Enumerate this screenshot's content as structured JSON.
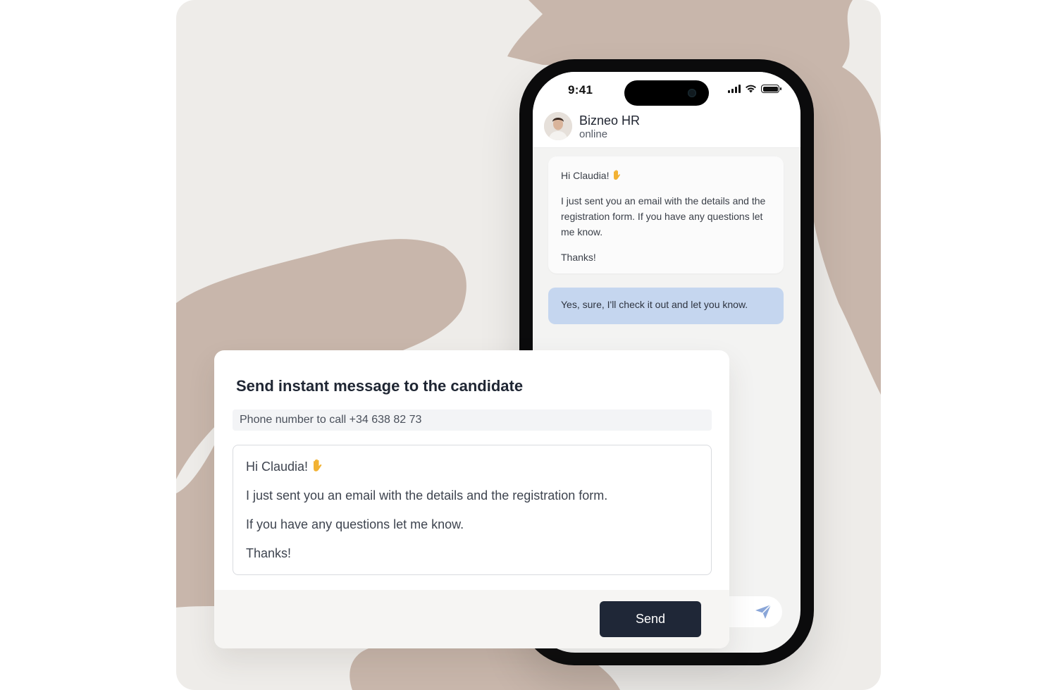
{
  "status_bar": {
    "time": "9:41",
    "icons": [
      "signal-icon",
      "wifi-icon",
      "battery-icon"
    ]
  },
  "chat": {
    "contact_name": "Bizneo HR",
    "contact_status": "online",
    "incoming": {
      "greeting": "Hi Claudia!",
      "body": "I just sent you an email with the details and the registration form. If you have any questions let me know.",
      "closing": "Thanks!"
    },
    "outgoing": "Yes, sure, I'll check it out and let you know.",
    "send_icon": "paper-plane-icon"
  },
  "card": {
    "title": "Send instant message to the candidate",
    "phone_line": "Phone number to call +34 638 82 73",
    "message": {
      "greeting": "Hi Claudia!",
      "line1": "I just sent you an email with the details and the registration form.",
      "line2": "If you have any questions let me know.",
      "closing": "Thanks!"
    },
    "send_label": "Send"
  },
  "colors": {
    "background": "#eeece9",
    "brush": "#c8b6ab",
    "outgoing_bubble": "#c5d6ef",
    "send_button": "#1f2737"
  }
}
